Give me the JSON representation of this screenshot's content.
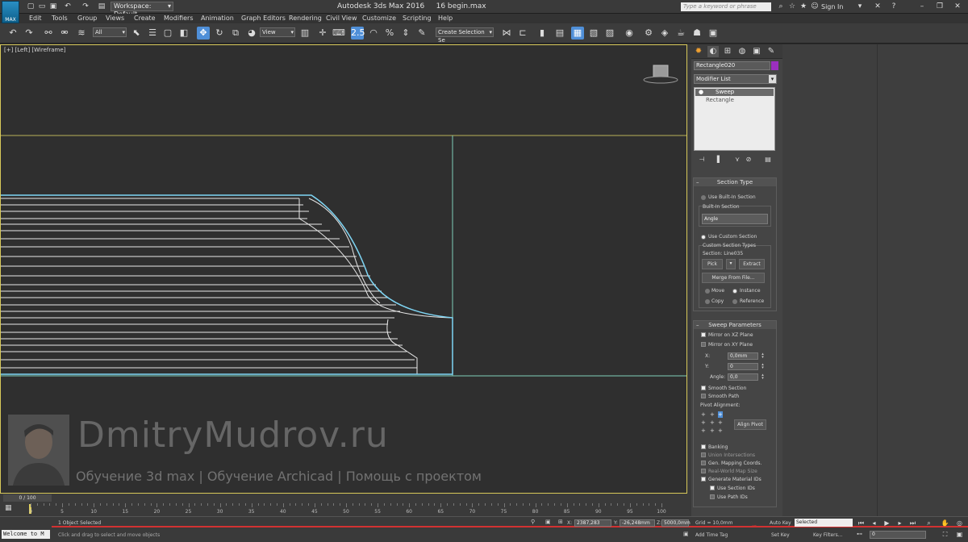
{
  "titlebar": {
    "logo": "MAX",
    "workspace": "Workspace: Default",
    "title": "Autodesk 3ds Max 2016",
    "file": "16 begin.max",
    "search_placeholder": "Type a keyword or phrase",
    "signin": "Sign In"
  },
  "menu": [
    "Edit",
    "Tools",
    "Group",
    "Views",
    "Create",
    "Modifiers",
    "Animation",
    "Graph Editors",
    "Rendering",
    "Civil View",
    "Customize",
    "Scripting",
    "Help"
  ],
  "toolbar": {
    "filter": "All",
    "refcoord": "View",
    "selection_set": "Create Selection Se",
    "snap_label": "2.5"
  },
  "viewport": {
    "label": "[+] [Left] [Wireframe]"
  },
  "panel": {
    "object_name": "Rectangle020",
    "object_color": "#9b2fbf",
    "modifier_list": "Modifier List",
    "stack": [
      "Sweep",
      "Rectangle"
    ],
    "section_type": {
      "title": "Section Type",
      "builtin_radio": "Use Built-In Section",
      "builtin_group": "Built-In Section",
      "builtin_value": "Angle",
      "custom_radio": "Use Custom Section",
      "custom_group": "Custom Section Types",
      "section_line": "Section: Line035",
      "pick": "Pick",
      "extract": "Extract",
      "merge": "Merge From File...",
      "move": "Move",
      "instance": "Instance",
      "copy": "Copy",
      "reference": "Reference"
    },
    "sweep_params": {
      "title": "Sweep Parameters",
      "mirror_xz": "Mirror on XZ Plane",
      "mirror_xy": "Mirror on XY Plane",
      "x_label": "X:",
      "x_value": "0,0mm",
      "y_label": "Y:",
      "y_value": "0",
      "angle_label": "Angle:",
      "angle_value": "0,0",
      "smooth_section": "Smooth Section",
      "smooth_path": "Smooth Path",
      "pivot_alignment": "Pivot Alignment:",
      "align_pivot": "Align Pivot",
      "banking": "Banking",
      "union": "Union Intersections",
      "gen_mapping": "Gen. Mapping Coords.",
      "real_world": "Real-World Map Size",
      "gen_material": "Generate Material IDs",
      "use_section_ids": "Use Section IDs",
      "use_path_ids": "Use Path IDs"
    }
  },
  "timeline": {
    "frame": "0 / 100",
    "ticks": [
      "0",
      "5",
      "10",
      "15",
      "20",
      "25",
      "30",
      "35",
      "40",
      "45",
      "50",
      "55",
      "60",
      "65",
      "70",
      "75",
      "80",
      "85",
      "90",
      "95",
      "100"
    ]
  },
  "status": {
    "maxscript": "Welcome to M",
    "selected": "1 Object Selected",
    "prompt": "Click and drag to select and move objects",
    "x": "2387,283",
    "y": "-26,248mm",
    "z": "5000,0mm",
    "grid": "Grid = 10,0mm",
    "add_time_tag": "Add Time Tag",
    "auto_key": "Auto Key",
    "selected_mode": "Selected",
    "set_key": "Set Key",
    "key_filters": "Key Filters...",
    "frame_field": "0"
  },
  "watermark": {
    "title": "DmitryMudrov.ru",
    "subtitle": "Обучение 3d max | Обучение Archicad | Помощь с проектом"
  }
}
